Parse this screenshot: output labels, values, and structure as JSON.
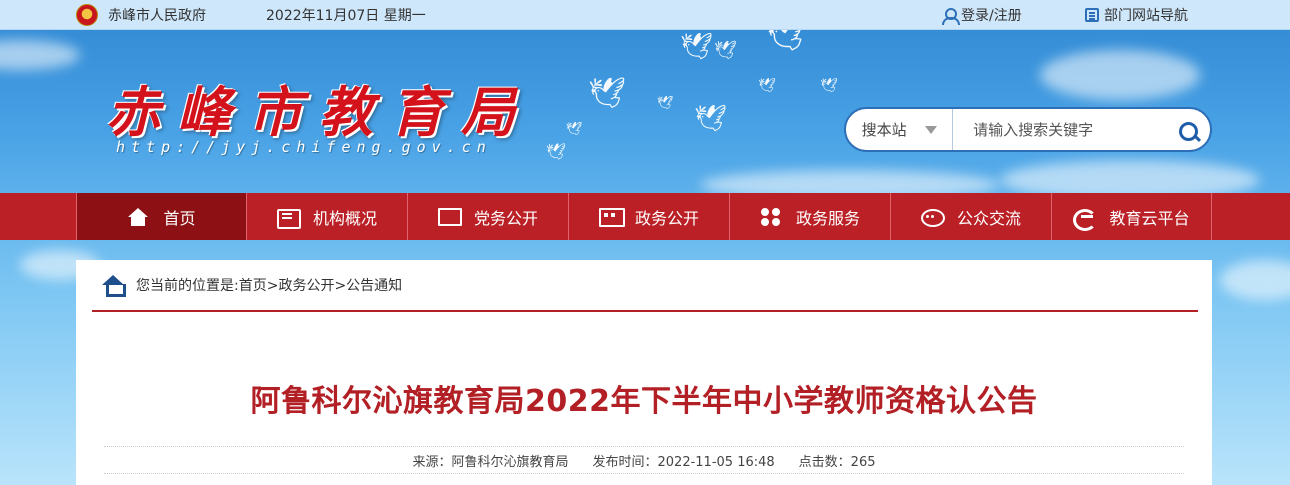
{
  "topbar": {
    "gov_name": "赤峰市人民政府",
    "date": "2022年11月07日 星期一",
    "login": "登录/注册",
    "dept_nav": "部门网站导航"
  },
  "header": {
    "title": "赤峰市教育局",
    "url": "http://jyj.chifeng.gov.cn"
  },
  "search": {
    "scope": "搜本站",
    "placeholder": "请输入搜索关键字"
  },
  "nav": {
    "items": [
      {
        "label": "首页",
        "icon": "home-icon"
      },
      {
        "label": "机构概况",
        "icon": "org-icon"
      },
      {
        "label": "党务公开",
        "icon": "monitor-icon"
      },
      {
        "label": "政务公开",
        "icon": "gov-icon"
      },
      {
        "label": "政务服务",
        "icon": "grid-icon"
      },
      {
        "label": "公众交流",
        "icon": "chat-icon"
      },
      {
        "label": "教育云平台",
        "icon": "cloud-icon"
      }
    ]
  },
  "breadcrumb": {
    "text": "您当前的位置是:首页>政务公开>公告通知"
  },
  "article": {
    "title": "阿鲁科尔沁旗教育局2022年下半年中小学教师资格认公告",
    "source": "来源：阿鲁科尔沁旗教育局",
    "publish_time": "发布时间：2022-11-05 16:48",
    "clicks": "点击数：265"
  },
  "colors": {
    "nav_bg": "#bb2026",
    "nav_active": "#8d1014",
    "title_red": "#b21f24",
    "topbar_bg": "#cfe7fb",
    "accent_blue": "#2c6fb7"
  }
}
